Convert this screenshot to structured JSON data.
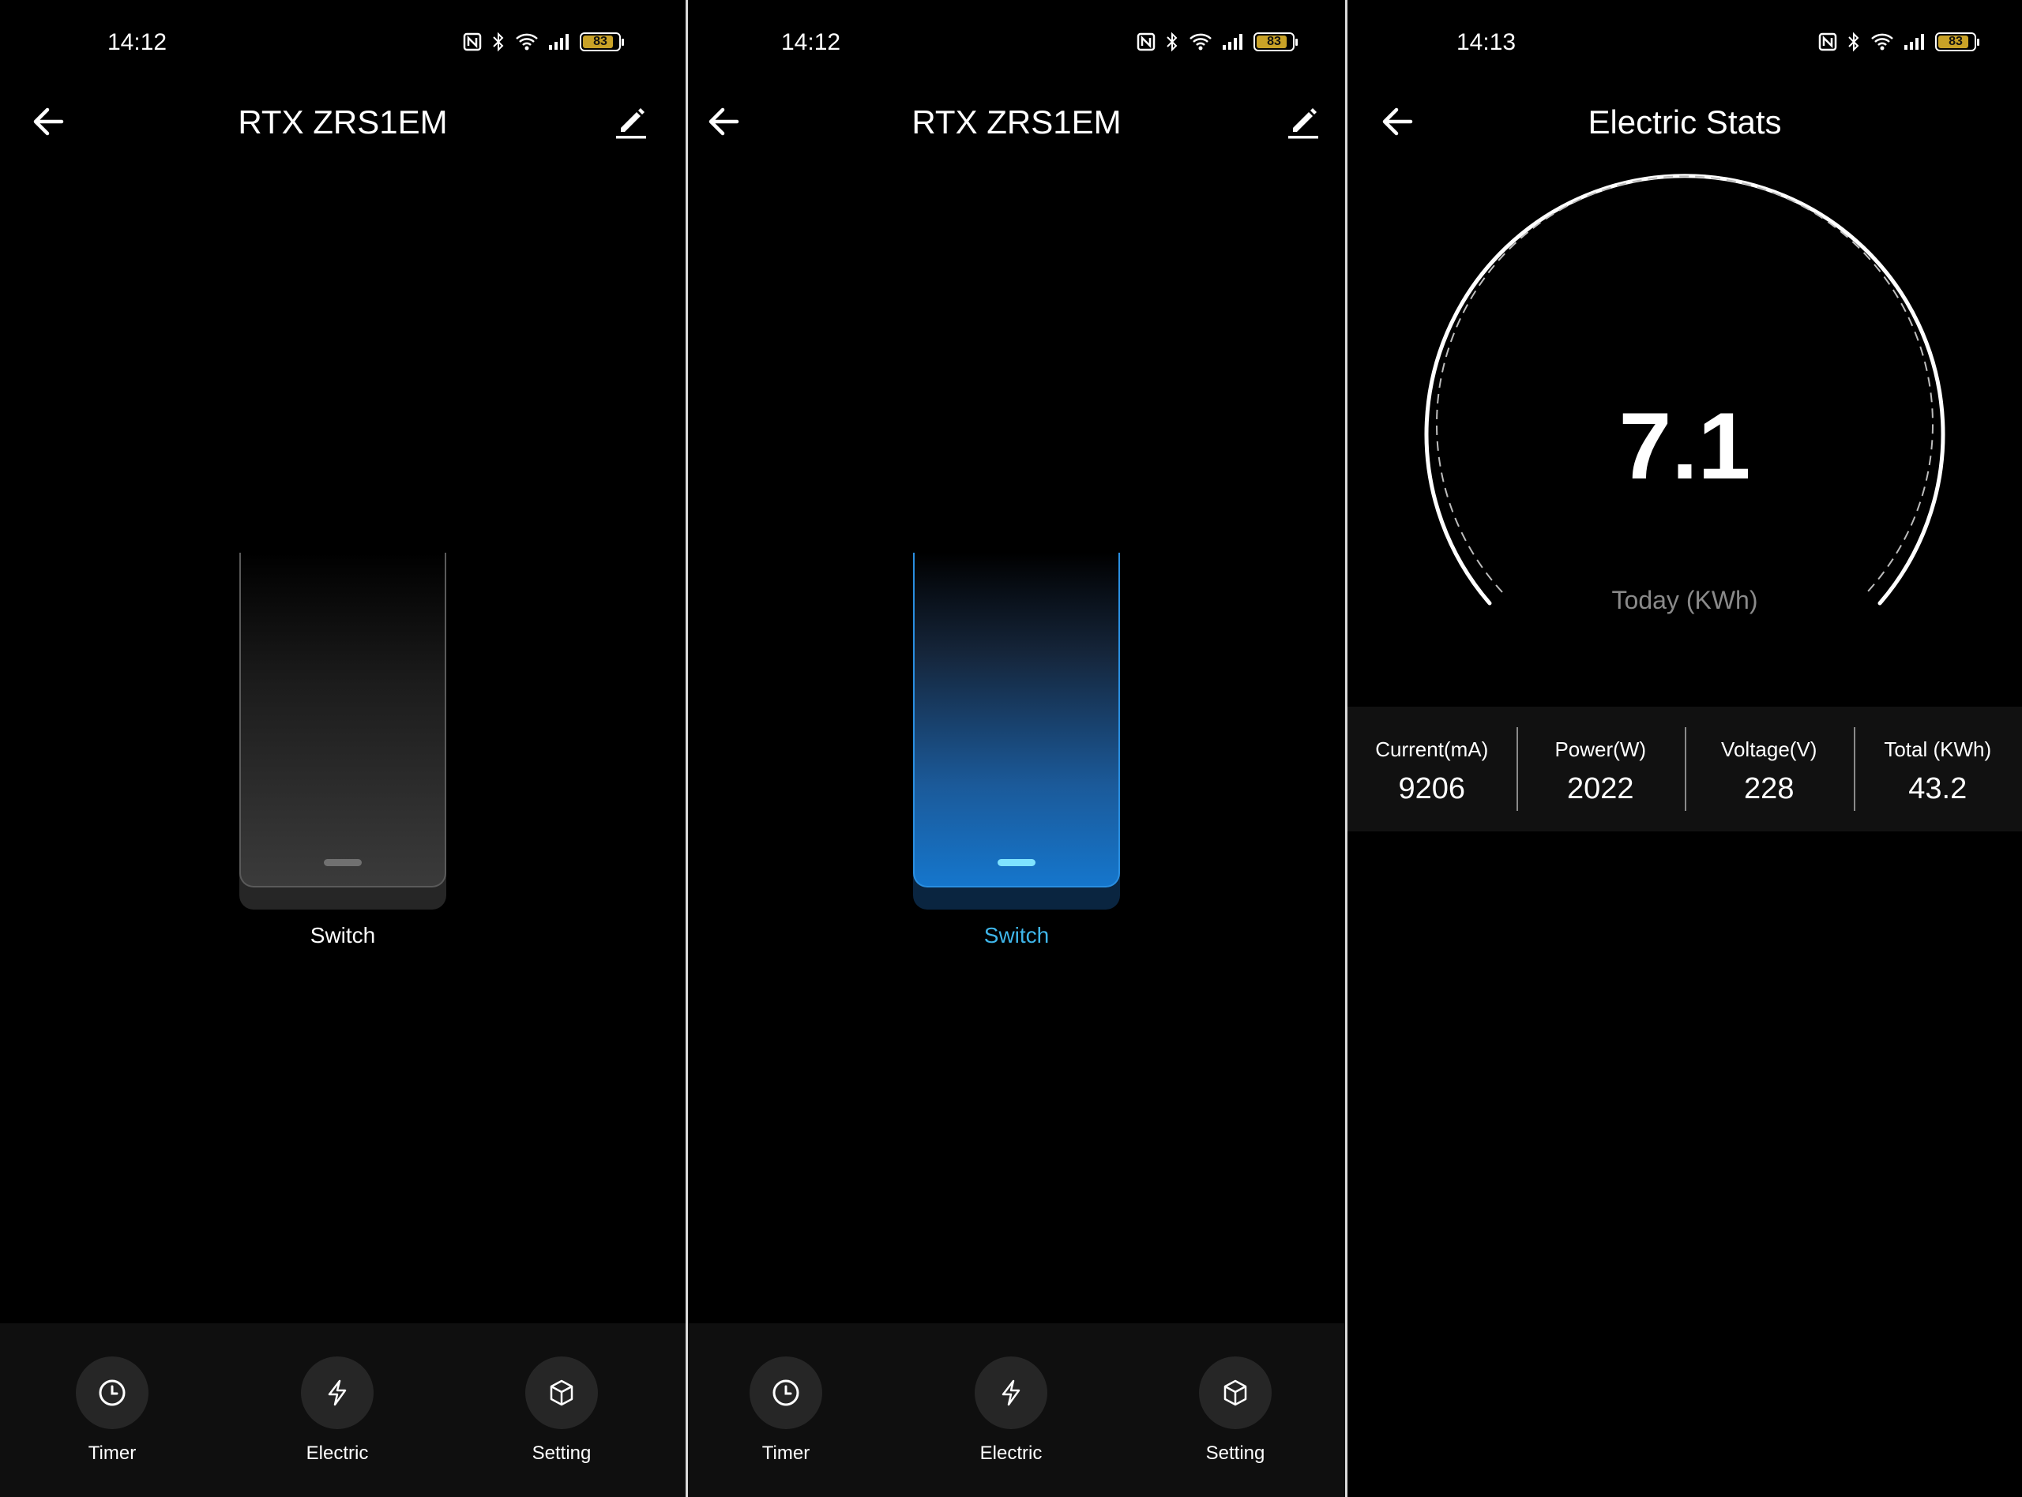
{
  "screens": [
    {
      "status": {
        "time": "14:12",
        "battery": "83"
      },
      "header": {
        "title": "RTX ZRS1EM"
      },
      "switch": {
        "label": "Switch",
        "state": "off"
      },
      "nav": [
        {
          "label": "Timer",
          "icon": "clock-icon"
        },
        {
          "label": "Electric",
          "icon": "lightning-icon"
        },
        {
          "label": "Setting",
          "icon": "cube-icon"
        }
      ]
    },
    {
      "status": {
        "time": "14:12",
        "battery": "83"
      },
      "header": {
        "title": "RTX ZRS1EM"
      },
      "switch": {
        "label": "Switch",
        "state": "on"
      },
      "nav": [
        {
          "label": "Timer",
          "icon": "clock-icon"
        },
        {
          "label": "Electric",
          "icon": "lightning-icon"
        },
        {
          "label": "Setting",
          "icon": "cube-icon"
        }
      ]
    },
    {
      "status": {
        "time": "14:13",
        "battery": "83"
      },
      "header": {
        "title": "Electric Stats"
      },
      "gauge": {
        "value": "7.1",
        "label": "Today (KWh)"
      },
      "stats": [
        {
          "label": "Current(mA)",
          "value": "9206"
        },
        {
          "label": "Power(W)",
          "value": "2022"
        },
        {
          "label": "Voltage(V)",
          "value": "228"
        },
        {
          "label": "Total (KWh)",
          "value": "43.2"
        }
      ]
    }
  ],
  "colors": {
    "accent": "#3fb6ea",
    "switch_on": "#1576cc",
    "battery": "#c9a227",
    "background": "#000000"
  }
}
